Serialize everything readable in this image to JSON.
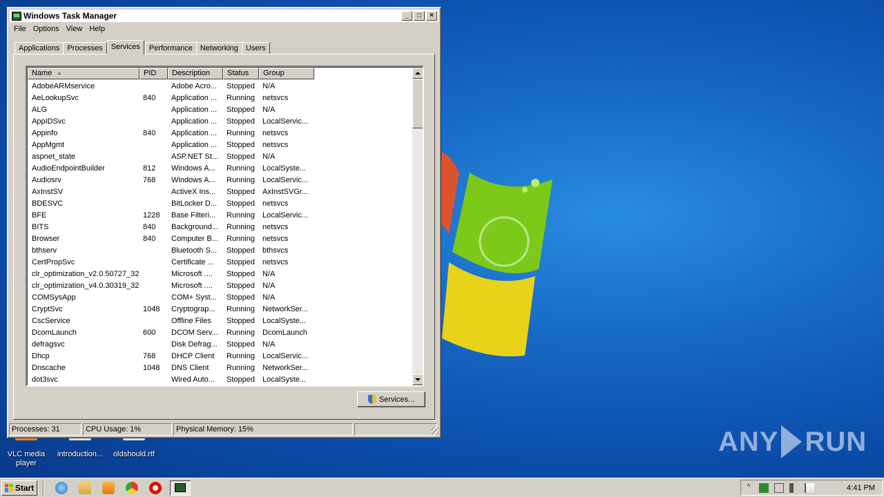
{
  "window": {
    "title": "Windows Task Manager",
    "min_label": "_",
    "max_label": "□",
    "close_label": "×"
  },
  "menu": [
    "File",
    "Options",
    "View",
    "Help"
  ],
  "tabs": [
    "Applications",
    "Processes",
    "Services",
    "Performance",
    "Networking",
    "Users"
  ],
  "active_tab": "Services",
  "columns": [
    "Name",
    "PID",
    "Description",
    "Status",
    "Group"
  ],
  "sorted_column": "Name",
  "services": [
    {
      "name": "AdobeARMservice",
      "pid": "",
      "description": "Adobe Acro...",
      "status": "Stopped",
      "group": "N/A"
    },
    {
      "name": "AeLookupSvc",
      "pid": "840",
      "description": "Application ...",
      "status": "Running",
      "group": "netsvcs"
    },
    {
      "name": "ALG",
      "pid": "",
      "description": "Application ...",
      "status": "Stopped",
      "group": "N/A"
    },
    {
      "name": "AppIDSvc",
      "pid": "",
      "description": "Application ...",
      "status": "Stopped",
      "group": "LocalServic..."
    },
    {
      "name": "Appinfo",
      "pid": "840",
      "description": "Application ...",
      "status": "Running",
      "group": "netsvcs"
    },
    {
      "name": "AppMgmt",
      "pid": "",
      "description": "Application ...",
      "status": "Stopped",
      "group": "netsvcs"
    },
    {
      "name": "aspnet_state",
      "pid": "",
      "description": "ASP.NET St...",
      "status": "Stopped",
      "group": "N/A"
    },
    {
      "name": "AudioEndpointBuilder",
      "pid": "812",
      "description": "Windows A...",
      "status": "Running",
      "group": "LocalSyste..."
    },
    {
      "name": "Audiosrv",
      "pid": "768",
      "description": "Windows A...",
      "status": "Running",
      "group": "LocalServic..."
    },
    {
      "name": "AxInstSV",
      "pid": "",
      "description": "ActiveX Ins...",
      "status": "Stopped",
      "group": "AxInstSVGr..."
    },
    {
      "name": "BDESVC",
      "pid": "",
      "description": "BitLocker D...",
      "status": "Stopped",
      "group": "netsvcs"
    },
    {
      "name": "BFE",
      "pid": "1228",
      "description": "Base Filteri...",
      "status": "Running",
      "group": "LocalServic..."
    },
    {
      "name": "BITS",
      "pid": "840",
      "description": "Background...",
      "status": "Running",
      "group": "netsvcs"
    },
    {
      "name": "Browser",
      "pid": "840",
      "description": "Computer B...",
      "status": "Running",
      "group": "netsvcs"
    },
    {
      "name": "bthserv",
      "pid": "",
      "description": "Bluetooth S...",
      "status": "Stopped",
      "group": "bthsvcs"
    },
    {
      "name": "CertPropSvc",
      "pid": "",
      "description": "Certificate ...",
      "status": "Stopped",
      "group": "netsvcs"
    },
    {
      "name": "clr_optimization_v2.0.50727_32",
      "pid": "",
      "description": "Microsoft ....",
      "status": "Stopped",
      "group": "N/A"
    },
    {
      "name": "clr_optimization_v4.0.30319_32",
      "pid": "",
      "description": "Microsoft ....",
      "status": "Stopped",
      "group": "N/A"
    },
    {
      "name": "COMSysApp",
      "pid": "",
      "description": "COM+ Syst...",
      "status": "Stopped",
      "group": "N/A"
    },
    {
      "name": "CryptSvc",
      "pid": "1048",
      "description": "Cryptograp...",
      "status": "Running",
      "group": "NetworkSer..."
    },
    {
      "name": "CscService",
      "pid": "",
      "description": "Offline Files",
      "status": "Stopped",
      "group": "LocalSyste..."
    },
    {
      "name": "DcomLaunch",
      "pid": "600",
      "description": "DCOM Serv...",
      "status": "Running",
      "group": "DcomLaunch"
    },
    {
      "name": "defragsvc",
      "pid": "",
      "description": "Disk Defrag...",
      "status": "Stopped",
      "group": "N/A"
    },
    {
      "name": "Dhcp",
      "pid": "768",
      "description": "DHCP Client",
      "status": "Running",
      "group": "LocalServic..."
    },
    {
      "name": "Dnscache",
      "pid": "1048",
      "description": "DNS Client",
      "status": "Running",
      "group": "NetworkSer..."
    },
    {
      "name": "dot3svc",
      "pid": "",
      "description": "Wired Auto...",
      "status": "Stopped",
      "group": "LocalSyste..."
    }
  ],
  "services_button": "Services...",
  "status": {
    "processes": "Processes: 31",
    "cpu": "CPU Usage: 1%",
    "memory": "Physical Memory: 15%"
  },
  "desktop_icons": [
    {
      "label": "VLC media player",
      "color": "#f08a1c"
    },
    {
      "label": "introduction...",
      "color": "#e0e4ec"
    },
    {
      "label": "oldshould.rtf",
      "color": "#e0e4ec"
    }
  ],
  "watermark": {
    "left": "ANY",
    "right": "RUN"
  },
  "taskbar": {
    "start_label": "Start",
    "clock": "4:41 PM"
  },
  "colors": {
    "desktop_bg": "#1667c4",
    "window_bg": "#d4d0c8",
    "flag_red": "#f04a1c",
    "flag_green": "#7cc91a",
    "flag_blue": "#1e8ff0",
    "flag_yellow": "#f6c21a"
  }
}
